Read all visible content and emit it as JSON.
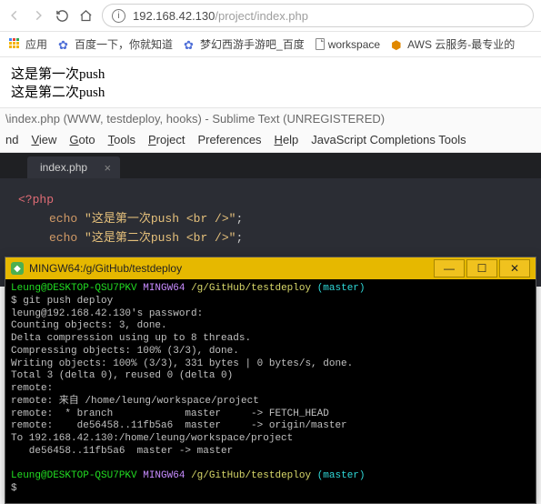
{
  "browser": {
    "url_host": "192.168.42.130",
    "url_path": "/project/index.php",
    "bookmarks": {
      "apps": "应用",
      "baidu": "百度一下，你就知道",
      "mhxy": "梦幻西游手游吧_百度",
      "workspace": "workspace",
      "aws": "AWS 云服务-最专业的"
    }
  },
  "page": {
    "line1": "这是第一次push",
    "line2": "这是第二次push"
  },
  "sublime": {
    "title": "\\index.php (WWW, testdeploy, hooks) - Sublime Text (UNREGISTERED)",
    "menu": {
      "find": "nd",
      "view": "View",
      "goto": "Goto",
      "tools": "Tools",
      "project": "Project",
      "preferences": "Preferences",
      "help": "Help",
      "jsc": "JavaScript Completions Tools"
    },
    "tab": "index.php",
    "code": {
      "l1": "<?php",
      "echo": "echo",
      "s1": "\"这是第一次push <br />\"",
      "s2": "\"这是第二次push <br />\"",
      "semi": ";"
    }
  },
  "terminal": {
    "title": "MINGW64:/g/GitHub/testdeploy",
    "btn_min": "—",
    "btn_max": "☐",
    "btn_close": "✕",
    "prompt_user": "Leung@DESKTOP-QSU7PKV",
    "prompt_env": "MINGW64",
    "prompt_path": "/g/GitHub/testdeploy",
    "prompt_branch": "(master)",
    "dollar": "$",
    "cmd": "git push deploy",
    "out": "leung@192.168.42.130's password:\nCounting objects: 3, done.\nDelta compression using up to 8 threads.\nCompressing objects: 100% (3/3), done.\nWriting objects: 100% (3/3), 331 bytes | 0 bytes/s, done.\nTotal 3 (delta 0), reused 0 (delta 0)\nremote:\nremote: 来自 /home/leung/workspace/project\nremote:  * branch            master     -> FETCH_HEAD\nremote:    de56458..11fb5a6  master     -> origin/master\nTo 192.168.42.130:/home/leung/workspace/project\n   de56458..11fb5a6  master -> master"
  }
}
